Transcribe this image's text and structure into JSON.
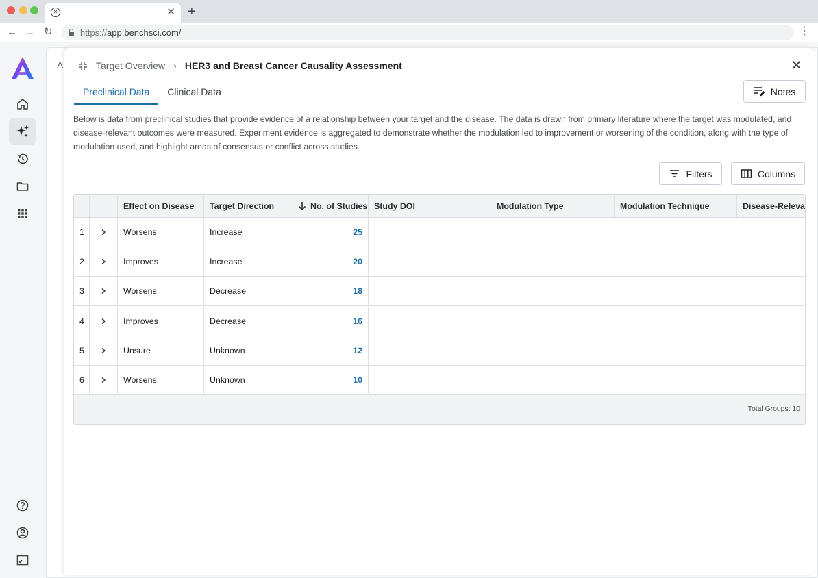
{
  "browser": {
    "url_scheme": "https://",
    "url_host": "app.benchsci.com/",
    "tab_close": "✕",
    "new_tab": "+"
  },
  "backdrop": {
    "text": "A:"
  },
  "breadcrumb": {
    "parent": "Target Overview",
    "separator": "›",
    "current": "HER3 and Breast Cancer Causality Assessment"
  },
  "tabs": [
    {
      "label": "Preclinical Data",
      "active": true
    },
    {
      "label": "Clinical Data",
      "active": false
    }
  ],
  "buttons": {
    "notes": "Notes",
    "filters": "Filters",
    "columns": "Columns"
  },
  "description": "Below is data from preclinical studies that provide evidence of a relationship between your target and the disease. The data is drawn from primary literature where the target was modulated, and disease-relevant outcomes were measured. Experiment evidence is aggregated to demonstrate whether the modulation led to improvement or worsening of the condition, along with the type of modulation used, and highlight areas of consensus or conflict across studies.",
  "table": {
    "headers": {
      "effect": "Effect on Disease",
      "direction": "Target Direction",
      "studies": "No. of Studies",
      "doi": "Study DOI",
      "mod_type": "Modulation Type",
      "mod_technique": "Modulation Technique",
      "disease_relevant": "Disease-Relevant"
    },
    "sort_column": "studies",
    "sort_direction": "descending",
    "rows": [
      {
        "index": "1",
        "effect": "Worsens",
        "direction": "Increase",
        "studies": "25"
      },
      {
        "index": "2",
        "effect": "Improves",
        "direction": "Increase",
        "studies": "20"
      },
      {
        "index": "3",
        "effect": "Worsens",
        "direction": "Decrease",
        "studies": "18"
      },
      {
        "index": "4",
        "effect": "Improves",
        "direction": "Decrease",
        "studies": "16"
      },
      {
        "index": "5",
        "effect": "Unsure",
        "direction": "Unknown",
        "studies": "12"
      },
      {
        "index": "6",
        "effect": "Worsens",
        "direction": "Unknown",
        "studies": "10"
      }
    ],
    "total_groups": "Total Groups: 10"
  },
  "colors": {
    "accent": "#1f6fa8",
    "logo_gradient": [
      "#e0479e",
      "#6a4cf0",
      "#2f7be8"
    ]
  },
  "sidebar_icons": [
    "home-icon",
    "sparkle-icon",
    "history-icon",
    "folder-icon",
    "apps-grid-icon",
    "help-icon",
    "account-icon",
    "fullscreen-icon"
  ]
}
